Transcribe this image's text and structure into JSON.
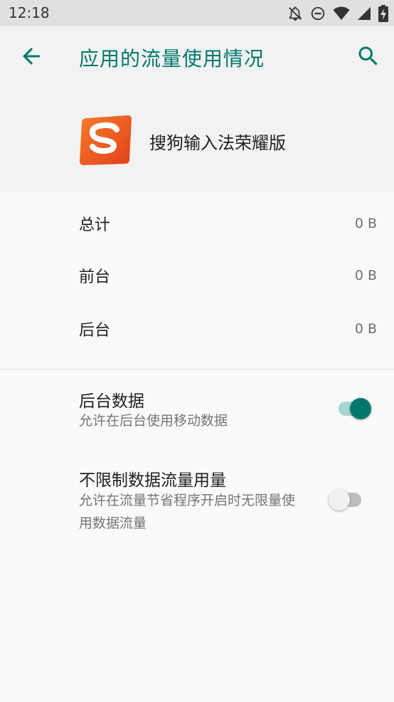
{
  "status_bar": {
    "time": "12:18",
    "icons": [
      "notifications-off-icon",
      "do-not-disturb-icon",
      "wifi-icon",
      "signal-icon",
      "battery-charging-icon"
    ]
  },
  "app_bar": {
    "title": "应用的流量使用情况",
    "back_icon": "arrow-back-icon",
    "search_icon": "search-icon",
    "accent_color": "#00796b"
  },
  "app": {
    "name": "搜狗输入法荣耀版",
    "logo_icon": "sogou-logo-icon",
    "logo_colors": [
      "#f36c21",
      "#e8401c"
    ]
  },
  "usage": [
    {
      "label": "总计",
      "value": "0 B"
    },
    {
      "label": "前台",
      "value": "0 B"
    },
    {
      "label": "后台",
      "value": "0 B"
    }
  ],
  "preferences": {
    "background_data": {
      "title": "后台数据",
      "summary": "允许在后台使用移动数据",
      "enabled": true
    },
    "unrestricted_data": {
      "title": "不限制数据流量用量",
      "summary": "允许在流量节省程序开启时无限量使用数据流量",
      "enabled": false
    }
  }
}
